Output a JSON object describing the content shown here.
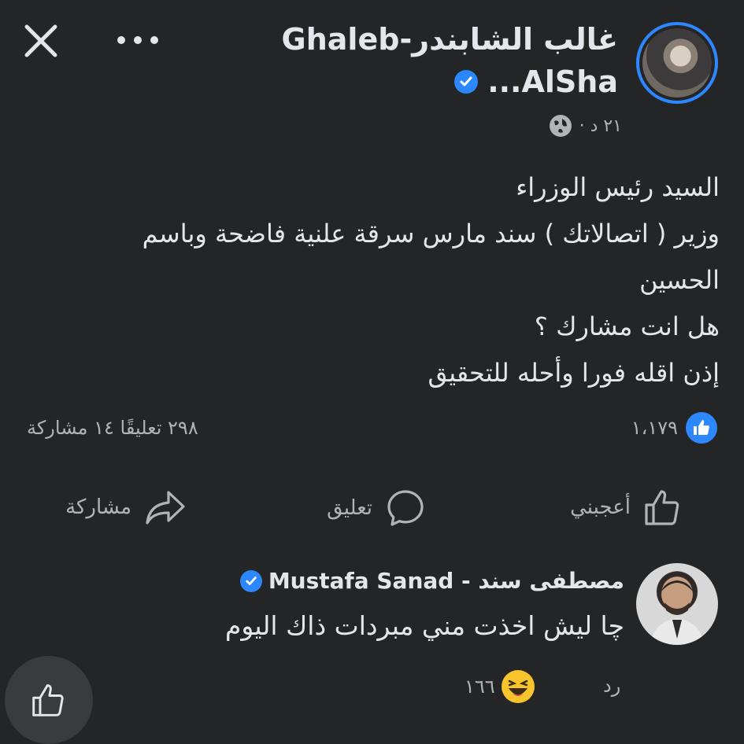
{
  "header": {
    "close_icon": "close-icon",
    "more_icon": "more-horizontal-icon"
  },
  "post": {
    "author_line1": "غالب الشابندر-Ghaleb",
    "author_line2": "AlSha...",
    "time": "٢١ د ·",
    "privacy_icon": "globe-icon",
    "lines": [
      "السيد رئيس الوزراء",
      "وزير ( اتصالاتك ) سند مارس سرقة علنية فاضحة وباسم",
      "الحسين",
      "هل انت مشارك ؟",
      "إذن اقله فورا وأحله للتحقيق"
    ],
    "reactions_count": "١،١٧٩",
    "comments_shares": "٢٩٨ تعليقًا  ١٤ مشاركة"
  },
  "actions": {
    "like": "أعجبني",
    "comment": "تعليق",
    "share": "مشاركة"
  },
  "comment": {
    "author": "مصطفى سند - Mustafa Sanad",
    "text": "چا ليش اخذت مني مبردات ذاك اليوم",
    "reply_label": "رد",
    "reaction_count": "١٦٦"
  },
  "colors": {
    "background": "#242526",
    "accent": "#2d88ff",
    "text": "#e4e6eb",
    "muted": "#b0b3b8"
  }
}
